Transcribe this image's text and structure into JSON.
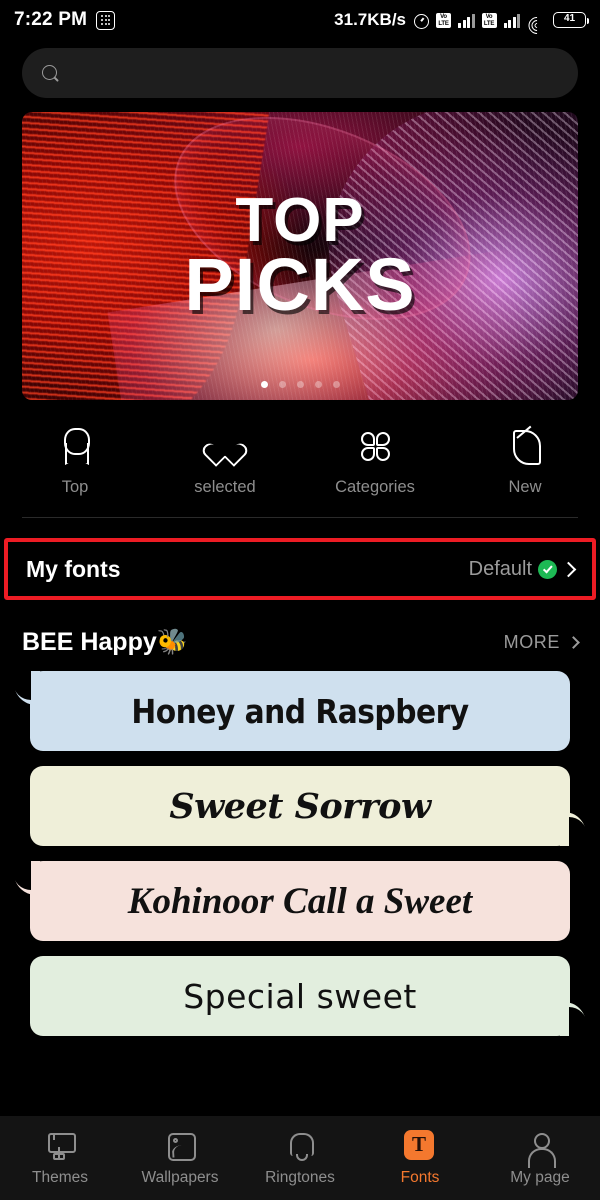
{
  "status_bar": {
    "time": "7:22 PM",
    "app_icon": "dot-grid-icon",
    "network_speed": "31.7KB/s",
    "alarm_icon": "alarm-clock-icon",
    "sim1_volte": "VoLTE",
    "sim2_volte": "VoLTE",
    "wifi_icon": "wifi-icon",
    "battery_level": "41"
  },
  "search": {
    "icon": "search-icon",
    "value": "",
    "placeholder": ""
  },
  "banner": {
    "title_line1": "TOP",
    "title_line2": "PICKS",
    "dot_count": 5,
    "active_dot": 1
  },
  "quick_nav": {
    "items": [
      {
        "label": "Top",
        "icon": "ribbon-badge-icon"
      },
      {
        "label": "selected",
        "icon": "heart-icon"
      },
      {
        "label": "Categories",
        "icon": "clover-grid-icon"
      },
      {
        "label": "New",
        "icon": "leaf-icon"
      }
    ]
  },
  "my_fonts": {
    "title": "My fonts",
    "value": "Default",
    "check_icon": "green-check-icon",
    "chevron_icon": "chevron-right-icon",
    "highlight_color": "#ed1c24"
  },
  "section": {
    "title": "BEE Happy🐝",
    "more_label": "MORE",
    "more_chevron": "chevron-right-icon"
  },
  "font_cards": [
    {
      "text": "Honey and Raspbery",
      "bg": "#cfe0ee",
      "tail": "top-left"
    },
    {
      "text": "Sweet Sorrow",
      "bg": "#efefd9",
      "tail": "bottom-right"
    },
    {
      "text": "Kohinoor  Call a Sweet",
      "bg": "#f6e2dc",
      "tail": "top-left"
    },
    {
      "text": "Special sweet",
      "bg": "#e2eede",
      "tail": "bottom-right"
    }
  ],
  "bottom_nav": {
    "active_color": "#f4782e",
    "items": [
      {
        "label": "Themes",
        "icon": "paint-roller-icon",
        "active": false
      },
      {
        "label": "Wallpapers",
        "icon": "image-icon",
        "active": false
      },
      {
        "label": "Ringtones",
        "icon": "bell-icon",
        "active": false
      },
      {
        "label": "Fonts",
        "icon": "font-t-icon",
        "active": true,
        "glyph": "T"
      },
      {
        "label": "My page",
        "icon": "person-icon",
        "active": false
      }
    ]
  }
}
